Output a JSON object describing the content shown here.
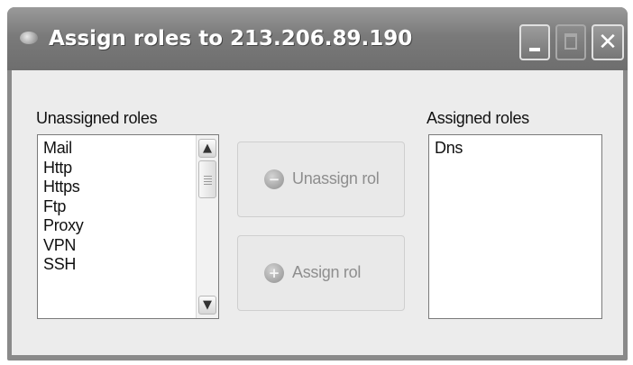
{
  "window": {
    "title": "Assign roles to 213.206.89.190",
    "minimize_glyph": "",
    "close_glyph": "✕"
  },
  "unassigned": {
    "label": "Unassigned roles",
    "items": [
      "Mail",
      "Http",
      "Https",
      "Ftp",
      "Proxy",
      "VPN",
      "SSH"
    ]
  },
  "assigned": {
    "label": "Assigned roles",
    "items": [
      "Dns"
    ]
  },
  "scrollbar": {
    "up_glyph": "▲",
    "down_glyph": "▼"
  },
  "buttons": {
    "unassign": {
      "label": "Unassign rol",
      "icon": "minus-circle-icon",
      "icon_glyph": "−",
      "enabled": false
    },
    "assign": {
      "label": "Assign rol",
      "icon": "plus-circle-icon",
      "icon_glyph": "+",
      "enabled": false
    }
  }
}
